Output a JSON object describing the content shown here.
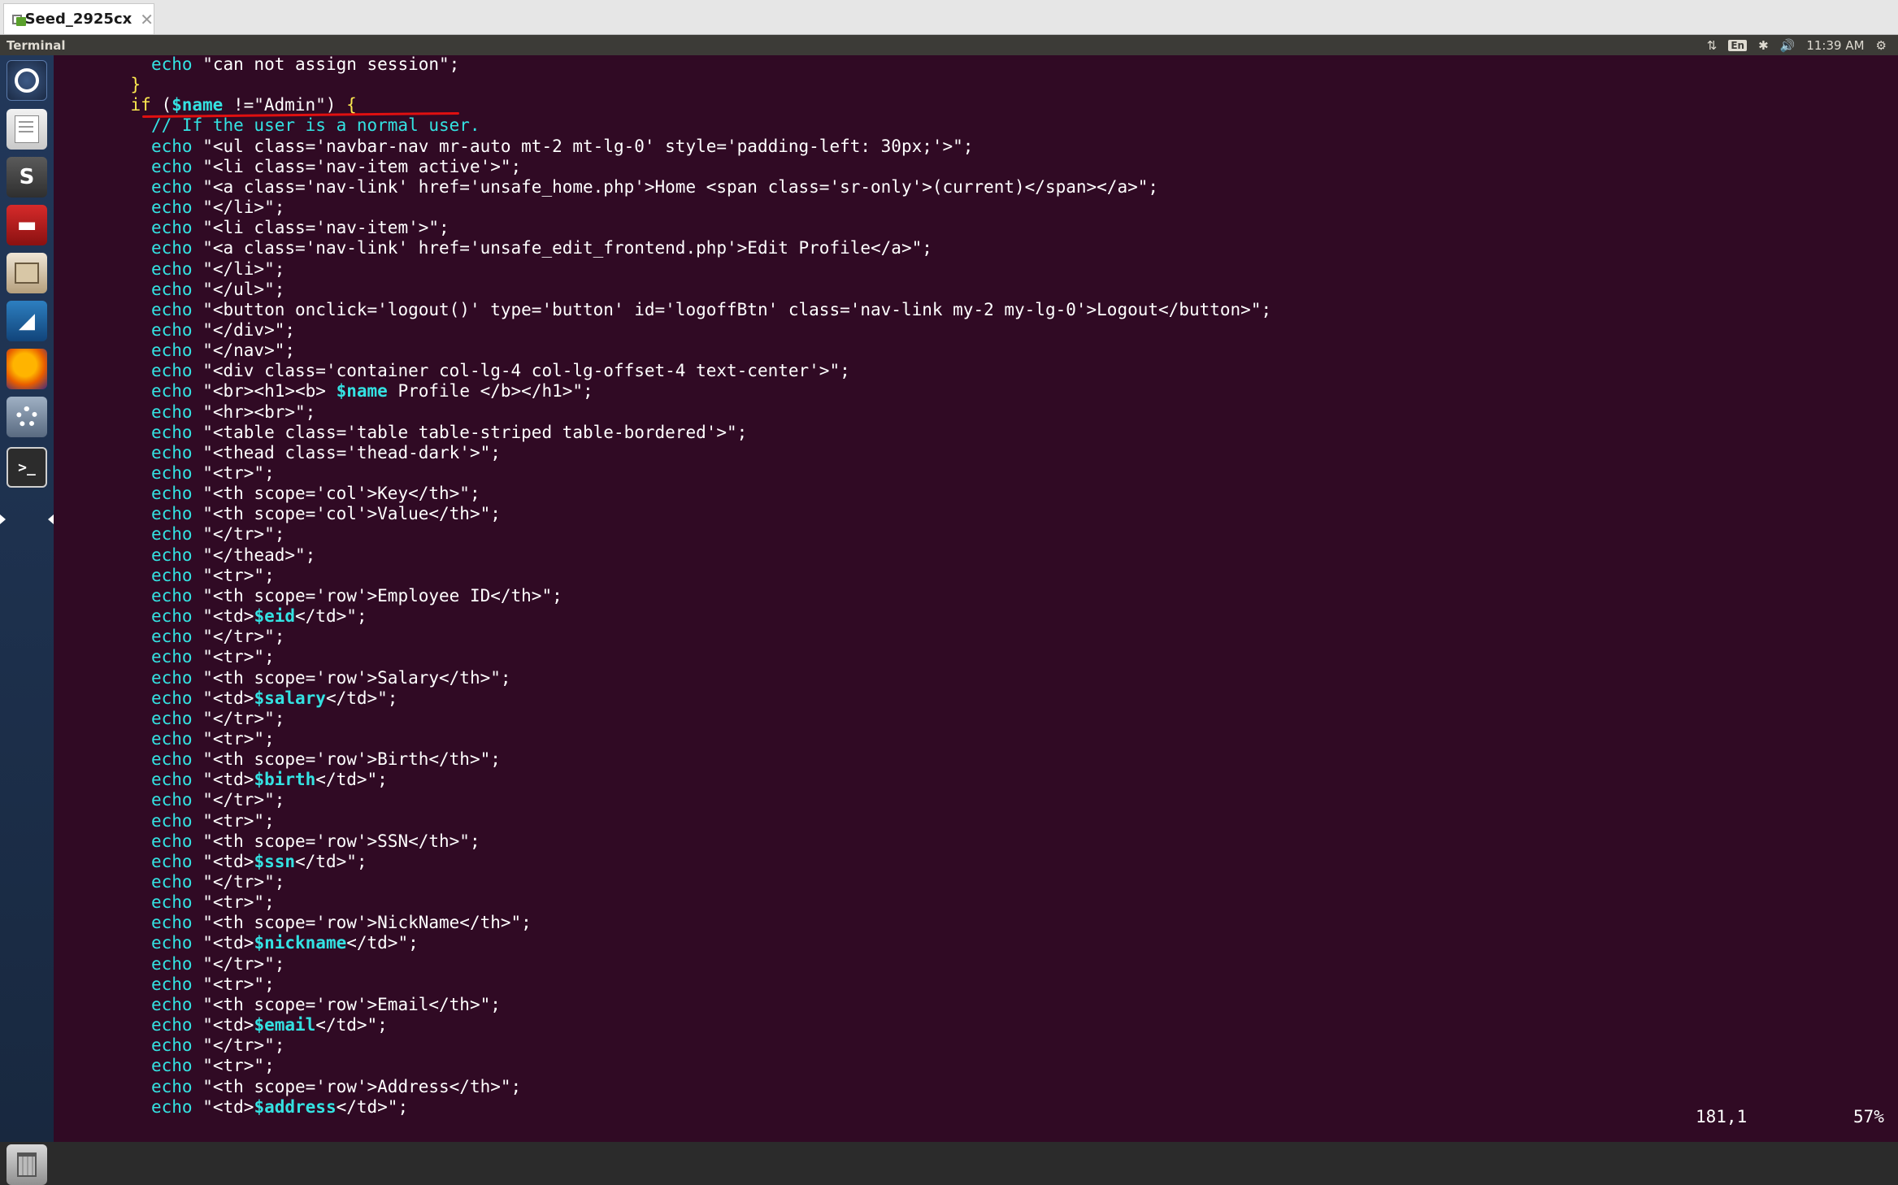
{
  "vm": {
    "tab_label": "Seed_2925cx",
    "close_glyph": "✕"
  },
  "top_panel": {
    "app_title": "Terminal",
    "indicators": {
      "network_icon": "network-updown-icon",
      "network_glyph": "⇅",
      "keyboard_lang": "En",
      "bluetooth_icon": "bluetooth-icon",
      "bluetooth_glyph": "✱",
      "volume_icon": "volume-icon",
      "volume_glyph": "🔊",
      "clock": "11:39 AM",
      "settings_icon": "system-gear-icon",
      "settings_glyph": "⚙"
    }
  },
  "launcher": {
    "items": [
      "dash-icon",
      "text-editor-icon",
      "sublime-text-icon",
      "red-app-icon",
      "files-icon",
      "wireshark-icon",
      "firefox-icon",
      "system-settings-icon",
      "terminal-icon",
      "trash-icon"
    ],
    "sublime_glyph": "S",
    "red_glyph": "▬",
    "wire_glyph": "◢",
    "terminal_prompt": ">_"
  },
  "editor": {
    "status_position": "181,1",
    "status_percent": "57%",
    "colors": {
      "background": "#300a24",
      "keyword": "#34e2e2",
      "if_keyword": "#fce94f",
      "underline": "#e01010"
    },
    "lines": [
      {
        "indent": 6,
        "tokens": [
          {
            "t": "echo",
            "c": "kw"
          },
          {
            "t": " \"can not assign session\";",
            "c": "str"
          }
        ]
      },
      {
        "indent": 4,
        "tokens": [
          {
            "t": "}",
            "c": "brace"
          }
        ]
      },
      {
        "indent": 4,
        "tokens": [
          {
            "t": "if",
            "c": "kw-if"
          },
          {
            "t": " (",
            "c": "plain"
          },
          {
            "t": "$name",
            "c": "var"
          },
          {
            "t": " !=",
            "c": "plain"
          },
          {
            "t": "\"Admin\"",
            "c": "str"
          },
          {
            "t": ") ",
            "c": "plain"
          },
          {
            "t": "{",
            "c": "brace"
          }
        ],
        "underlined": true
      },
      {
        "indent": 6,
        "tokens": [
          {
            "t": "// If the user is a normal user.",
            "c": "cmt"
          }
        ]
      },
      {
        "indent": 6,
        "tokens": [
          {
            "t": "echo",
            "c": "kw"
          },
          {
            "t": " \"<ul class='navbar-nav mr-auto mt-2 mt-lg-0' style='padding-left: 30px;'>\";",
            "c": "str"
          }
        ]
      },
      {
        "indent": 6,
        "tokens": [
          {
            "t": "echo",
            "c": "kw"
          },
          {
            "t": " \"<li class='nav-item active'>\";",
            "c": "str"
          }
        ]
      },
      {
        "indent": 6,
        "tokens": [
          {
            "t": "echo",
            "c": "kw"
          },
          {
            "t": " \"<a class='nav-link' href='unsafe_home.php'>Home <span class='sr-only'>(current)</span></a>\";",
            "c": "str"
          }
        ]
      },
      {
        "indent": 6,
        "tokens": [
          {
            "t": "echo",
            "c": "kw"
          },
          {
            "t": " \"</li>\";",
            "c": "str"
          }
        ]
      },
      {
        "indent": 6,
        "tokens": [
          {
            "t": "echo",
            "c": "kw"
          },
          {
            "t": " \"<li class='nav-item'>\";",
            "c": "str"
          }
        ]
      },
      {
        "indent": 6,
        "tokens": [
          {
            "t": "echo",
            "c": "kw"
          },
          {
            "t": " \"<a class='nav-link' href='unsafe_edit_frontend.php'>Edit Profile</a>\";",
            "c": "str"
          }
        ]
      },
      {
        "indent": 6,
        "tokens": [
          {
            "t": "echo",
            "c": "kw"
          },
          {
            "t": " \"</li>\";",
            "c": "str"
          }
        ]
      },
      {
        "indent": 6,
        "tokens": [
          {
            "t": "echo",
            "c": "kw"
          },
          {
            "t": " \"</ul>\";",
            "c": "str"
          }
        ]
      },
      {
        "indent": 6,
        "tokens": [
          {
            "t": "echo",
            "c": "kw"
          },
          {
            "t": " \"<button onclick='logout()' type='button' id='logoffBtn' class='nav-link my-2 my-lg-0'>Logout</button>\";",
            "c": "str"
          }
        ]
      },
      {
        "indent": 6,
        "tokens": [
          {
            "t": "echo",
            "c": "kw"
          },
          {
            "t": " \"</div>\";",
            "c": "str"
          }
        ]
      },
      {
        "indent": 6,
        "tokens": [
          {
            "t": "echo",
            "c": "kw"
          },
          {
            "t": " \"</nav>\";",
            "c": "str"
          }
        ]
      },
      {
        "indent": 6,
        "tokens": [
          {
            "t": "echo",
            "c": "kw"
          },
          {
            "t": " \"<div class='container col-lg-4 col-lg-offset-4 text-center'>\";",
            "c": "str"
          }
        ]
      },
      {
        "indent": 6,
        "tokens": [
          {
            "t": "echo",
            "c": "kw"
          },
          {
            "t": " \"<br><h1><b> ",
            "c": "str"
          },
          {
            "t": "$name",
            "c": "var"
          },
          {
            "t": " Profile </b></h1>\";",
            "c": "str"
          }
        ]
      },
      {
        "indent": 6,
        "tokens": [
          {
            "t": "echo",
            "c": "kw"
          },
          {
            "t": " \"<hr><br>\";",
            "c": "str"
          }
        ]
      },
      {
        "indent": 6,
        "tokens": [
          {
            "t": "echo",
            "c": "kw"
          },
          {
            "t": " \"<table class='table table-striped table-bordered'>\";",
            "c": "str"
          }
        ]
      },
      {
        "indent": 6,
        "tokens": [
          {
            "t": "echo",
            "c": "kw"
          },
          {
            "t": " \"<thead class='thead-dark'>\";",
            "c": "str"
          }
        ]
      },
      {
        "indent": 6,
        "tokens": [
          {
            "t": "echo",
            "c": "kw"
          },
          {
            "t": " \"<tr>\";",
            "c": "str"
          }
        ]
      },
      {
        "indent": 6,
        "tokens": [
          {
            "t": "echo",
            "c": "kw"
          },
          {
            "t": " \"<th scope='col'>Key</th>\";",
            "c": "str"
          }
        ]
      },
      {
        "indent": 6,
        "tokens": [
          {
            "t": "echo",
            "c": "kw"
          },
          {
            "t": " \"<th scope='col'>Value</th>\";",
            "c": "str"
          }
        ]
      },
      {
        "indent": 6,
        "tokens": [
          {
            "t": "echo",
            "c": "kw"
          },
          {
            "t": " \"</tr>\";",
            "c": "str"
          }
        ]
      },
      {
        "indent": 6,
        "tokens": [
          {
            "t": "echo",
            "c": "kw"
          },
          {
            "t": " \"</thead>\";",
            "c": "str"
          }
        ]
      },
      {
        "indent": 6,
        "tokens": [
          {
            "t": "echo",
            "c": "kw"
          },
          {
            "t": " \"<tr>\";",
            "c": "str"
          }
        ]
      },
      {
        "indent": 6,
        "tokens": [
          {
            "t": "echo",
            "c": "kw"
          },
          {
            "t": " \"<th scope='row'>Employee ID</th>\";",
            "c": "str"
          }
        ]
      },
      {
        "indent": 6,
        "tokens": [
          {
            "t": "echo",
            "c": "kw"
          },
          {
            "t": " \"<td>",
            "c": "str"
          },
          {
            "t": "$eid",
            "c": "var"
          },
          {
            "t": "</td>\";",
            "c": "str"
          }
        ]
      },
      {
        "indent": 6,
        "tokens": [
          {
            "t": "echo",
            "c": "kw"
          },
          {
            "t": " \"</tr>\";",
            "c": "str"
          }
        ]
      },
      {
        "indent": 6,
        "tokens": [
          {
            "t": "echo",
            "c": "kw"
          },
          {
            "t": " \"<tr>\";",
            "c": "str"
          }
        ]
      },
      {
        "indent": 6,
        "tokens": [
          {
            "t": "echo",
            "c": "kw"
          },
          {
            "t": " \"<th scope='row'>Salary</th>\";",
            "c": "str"
          }
        ]
      },
      {
        "indent": 6,
        "tokens": [
          {
            "t": "echo",
            "c": "kw"
          },
          {
            "t": " \"<td>",
            "c": "str"
          },
          {
            "t": "$salary",
            "c": "var"
          },
          {
            "t": "</td>\";",
            "c": "str"
          }
        ]
      },
      {
        "indent": 6,
        "tokens": [
          {
            "t": "echo",
            "c": "kw"
          },
          {
            "t": " \"</tr>\";",
            "c": "str"
          }
        ]
      },
      {
        "indent": 6,
        "tokens": [
          {
            "t": "echo",
            "c": "kw"
          },
          {
            "t": " \"<tr>\";",
            "c": "str"
          }
        ]
      },
      {
        "indent": 6,
        "tokens": [
          {
            "t": "echo",
            "c": "kw"
          },
          {
            "t": " \"<th scope='row'>Birth</th>\";",
            "c": "str"
          }
        ]
      },
      {
        "indent": 6,
        "tokens": [
          {
            "t": "echo",
            "c": "kw"
          },
          {
            "t": " \"<td>",
            "c": "str"
          },
          {
            "t": "$birth",
            "c": "var"
          },
          {
            "t": "</td>\";",
            "c": "str"
          }
        ]
      },
      {
        "indent": 6,
        "tokens": [
          {
            "t": "echo",
            "c": "kw"
          },
          {
            "t": " \"</tr>\";",
            "c": "str"
          }
        ]
      },
      {
        "indent": 6,
        "tokens": [
          {
            "t": "echo",
            "c": "kw"
          },
          {
            "t": " \"<tr>\";",
            "c": "str"
          }
        ]
      },
      {
        "indent": 6,
        "tokens": [
          {
            "t": "echo",
            "c": "kw"
          },
          {
            "t": " \"<th scope='row'>SSN</th>\";",
            "c": "str"
          }
        ]
      },
      {
        "indent": 6,
        "tokens": [
          {
            "t": "echo",
            "c": "kw"
          },
          {
            "t": " \"<td>",
            "c": "str"
          },
          {
            "t": "$ssn",
            "c": "var"
          },
          {
            "t": "</td>\";",
            "c": "str"
          }
        ]
      },
      {
        "indent": 6,
        "tokens": [
          {
            "t": "echo",
            "c": "kw"
          },
          {
            "t": " \"</tr>\";",
            "c": "str"
          }
        ]
      },
      {
        "indent": 6,
        "tokens": [
          {
            "t": "echo",
            "c": "kw"
          },
          {
            "t": " \"<tr>\";",
            "c": "str"
          }
        ]
      },
      {
        "indent": 6,
        "tokens": [
          {
            "t": "echo",
            "c": "kw"
          },
          {
            "t": " \"<th scope='row'>NickName</th>\";",
            "c": "str"
          }
        ]
      },
      {
        "indent": 6,
        "tokens": [
          {
            "t": "echo",
            "c": "kw"
          },
          {
            "t": " \"<td>",
            "c": "str"
          },
          {
            "t": "$nickname",
            "c": "var"
          },
          {
            "t": "</td>\";",
            "c": "str"
          }
        ]
      },
      {
        "indent": 6,
        "tokens": [
          {
            "t": "echo",
            "c": "kw"
          },
          {
            "t": " \"</tr>\";",
            "c": "str"
          }
        ]
      },
      {
        "indent": 6,
        "tokens": [
          {
            "t": "echo",
            "c": "kw"
          },
          {
            "t": " \"<tr>\";",
            "c": "str"
          }
        ]
      },
      {
        "indent": 6,
        "tokens": [
          {
            "t": "echo",
            "c": "kw"
          },
          {
            "t": " \"<th scope='row'>Email</th>\";",
            "c": "str"
          }
        ]
      },
      {
        "indent": 6,
        "tokens": [
          {
            "t": "echo",
            "c": "kw"
          },
          {
            "t": " \"<td>",
            "c": "str"
          },
          {
            "t": "$email",
            "c": "var"
          },
          {
            "t": "</td>\";",
            "c": "str"
          }
        ]
      },
      {
        "indent": 6,
        "tokens": [
          {
            "t": "echo",
            "c": "kw"
          },
          {
            "t": " \"</tr>\";",
            "c": "str"
          }
        ]
      },
      {
        "indent": 6,
        "tokens": [
          {
            "t": "echo",
            "c": "kw"
          },
          {
            "t": " \"<tr>\";",
            "c": "str"
          }
        ]
      },
      {
        "indent": 6,
        "tokens": [
          {
            "t": "echo",
            "c": "kw"
          },
          {
            "t": " \"<th scope='row'>Address</th>\";",
            "c": "str"
          }
        ]
      },
      {
        "indent": 6,
        "tokens": [
          {
            "t": "echo",
            "c": "kw"
          },
          {
            "t": " \"<td>",
            "c": "str"
          },
          {
            "t": "$address",
            "c": "var"
          },
          {
            "t": "</td>\";",
            "c": "str"
          }
        ]
      }
    ]
  }
}
